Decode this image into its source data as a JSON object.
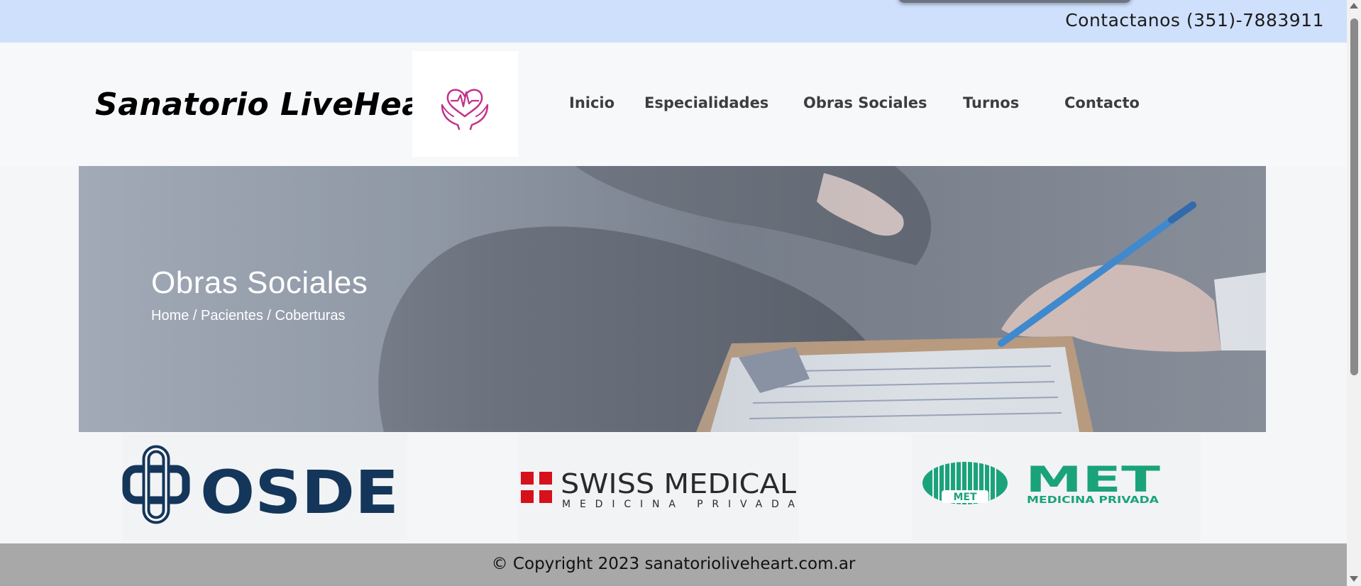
{
  "topbar": {
    "contact": "Contactanos (351)-7883911"
  },
  "header": {
    "brand": "Sanatorio LiveHeart",
    "logo_icon": "heart-hands-icon",
    "nav": [
      "Inicio",
      "Especialidades",
      "Obras Sociales",
      "Turnos",
      "Contacto"
    ]
  },
  "hero": {
    "title": "Obras Sociales",
    "breadcrumb": [
      "Home",
      "Pacientes",
      "Coberturas"
    ],
    "breadcrumb_separator": " / "
  },
  "insurers": [
    {
      "name": "OSDE",
      "wordmark": "OSDE",
      "color": "#14365a"
    },
    {
      "name": "Swiss Medical",
      "wordmark": "SWISS MEDICAL",
      "tagline": "MEDICINA PRIVADA",
      "color": "#d5111c"
    },
    {
      "name": "MET",
      "wordmark": "MET",
      "tagline": "MEDICINA PRIVADA",
      "color": "#1aa37a"
    }
  ],
  "footer": {
    "copyright": "© Copyright 2023 sanatorioliveheart.com.ar"
  },
  "colors": {
    "topbar_bg": "#cfe0fc",
    "footer_bg": "#a8a8a8",
    "logo_pink": "#c0338a"
  }
}
